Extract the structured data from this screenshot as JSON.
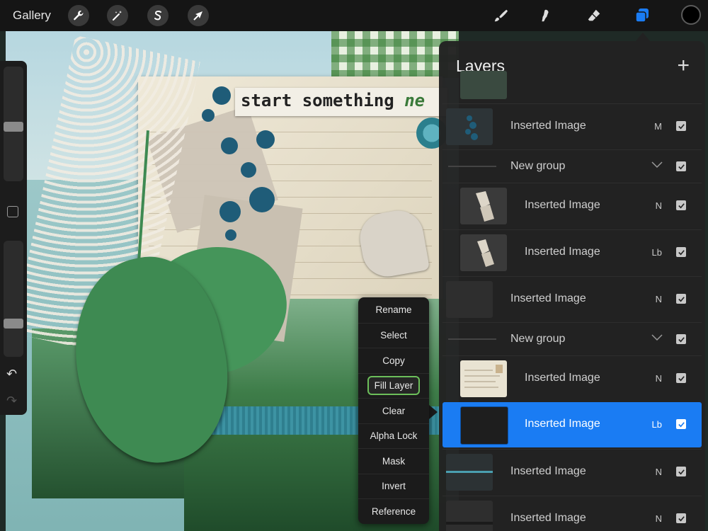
{
  "topbar": {
    "gallery_label": "Gallery",
    "left_tools": [
      "wrench-icon",
      "magic-wand-icon",
      "selection-s-icon",
      "transform-arrow-icon"
    ],
    "right_tools": [
      "brush-icon",
      "smudge-icon",
      "eraser-icon",
      "layers-icon"
    ],
    "active_tool": "layers-icon",
    "active_color": "#1a7cf3",
    "current_color": "#000000"
  },
  "canvas": {
    "label_text": "start something",
    "label_tail": "ne"
  },
  "sidebar": {
    "undo_icon": "↶",
    "redo_icon": "↷"
  },
  "context_menu": {
    "items": [
      "Rename",
      "Select",
      "Copy",
      "Fill Layer",
      "Clear",
      "Alpha Lock",
      "Mask",
      "Invert",
      "Reference"
    ],
    "selected": "Fill Layer"
  },
  "layers_panel": {
    "title": "Layers",
    "add_icon": "+",
    "rows": [
      {
        "name": "Inserted Image",
        "blend": "M",
        "type": "layer"
      },
      {
        "name": "New group",
        "blend": "",
        "type": "group"
      },
      {
        "name": "Inserted Image",
        "blend": "N",
        "type": "layer"
      },
      {
        "name": "Inserted Image",
        "blend": "Lb",
        "type": "layer"
      },
      {
        "name": "Inserted Image",
        "blend": "N",
        "type": "layer"
      },
      {
        "name": "New group",
        "blend": "",
        "type": "group"
      },
      {
        "name": "Inserted Image",
        "blend": "N",
        "type": "layer"
      },
      {
        "name": "Inserted Image",
        "blend": "Lb",
        "type": "layer",
        "active": true
      },
      {
        "name": "Inserted Image",
        "blend": "N",
        "type": "layer"
      },
      {
        "name": "Inserted Image",
        "blend": "N",
        "type": "layer"
      }
    ]
  }
}
